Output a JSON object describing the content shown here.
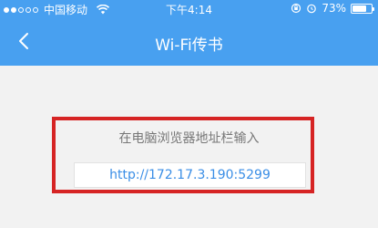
{
  "statusbar": {
    "carrier": "中国移动",
    "time": "下午4:14",
    "battery_percent": 73,
    "battery_text": "73%"
  },
  "navbar": {
    "title": "Wi-Fi传书",
    "back_icon": "chevron-left-icon"
  },
  "content": {
    "hint": "在电脑浏览器地址栏输入",
    "url": "http://172.17.3.190:5299"
  },
  "colors": {
    "nav_background": "#48a0f0",
    "url_text": "#3a8ee6",
    "highlight_border": "#d62424"
  }
}
